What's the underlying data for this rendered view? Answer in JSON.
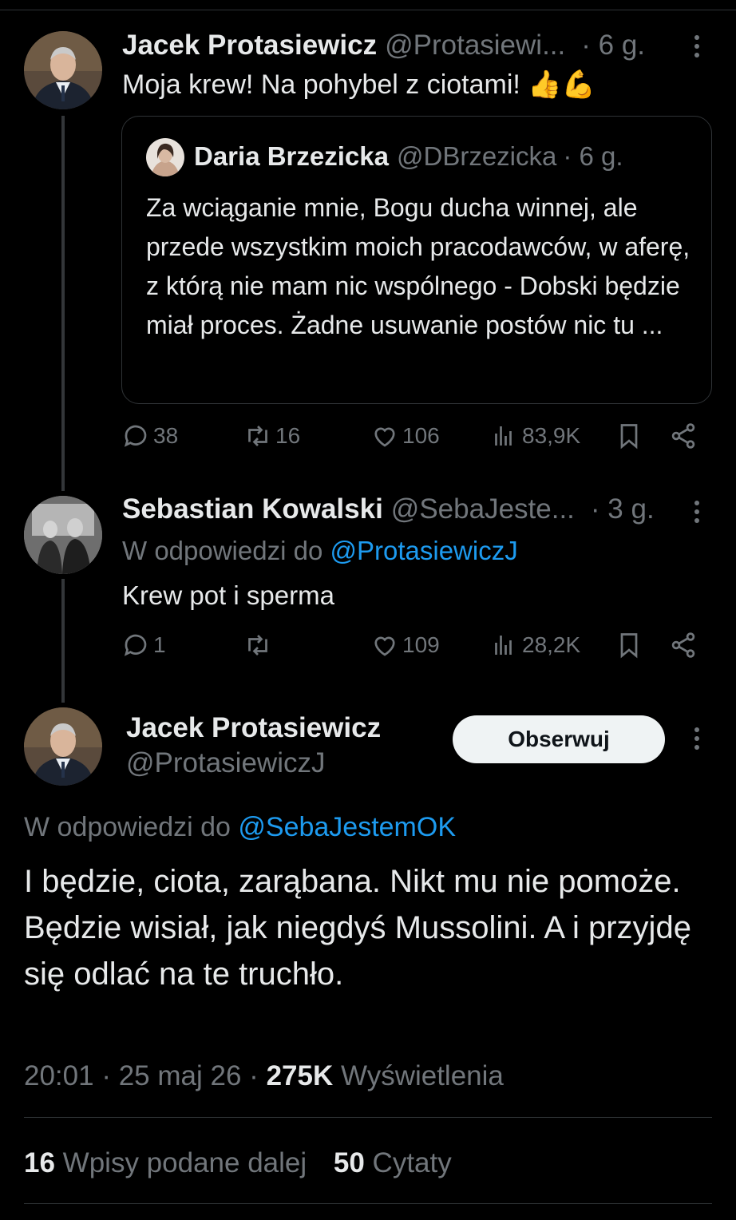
{
  "tweet1": {
    "name": "Jacek Protasiewicz",
    "handle": "@Protasiewi...",
    "time": "· 6 g.",
    "text": "Moja krew! Na pohybel z ciotami! 👍💪",
    "quote": {
      "name": "Daria Brzezicka",
      "handle": "@DBrzezicka",
      "time": "· 6 g.",
      "text": "Za wciąganie mnie, Bogu ducha winnej, ale przede wszystkim moich pracodawców, w aferę, z którą nie mam nic wspólnego - Dobski będzie miał proces. Żadne usuwanie postów nic tu ..."
    },
    "replies": "38",
    "reposts": "16",
    "likes": "106",
    "views": "83,9K"
  },
  "tweet2": {
    "name": "Sebastian Kowalski",
    "handle": "@SebaJeste...",
    "time": "· 3 g.",
    "reply_prefix": "W odpowiedzi do",
    "reply_to": "@ProtasiewiczJ",
    "text": "Krew pot i sperma",
    "replies": "1",
    "reposts": "",
    "likes": "109",
    "views": "28,2K"
  },
  "main": {
    "name": "Jacek Protasiewicz",
    "handle": "@ProtasiewiczJ",
    "follow_label": "Obserwuj",
    "reply_prefix": "W odpowiedzi do",
    "reply_to": "@SebaJestemOK",
    "text": "I będzie, ciota, zarąbana. Nikt mu nie pomoże. Będzie wisiał, jak niegdyś Mussolini. A i przyjdę się odlać  na te truchło.",
    "time": "20:01",
    "date": "25 maj 26",
    "views_count": "275K",
    "views_label": "Wyświetlenia",
    "reposts_count": "16",
    "reposts_label": "Wpisy podane dalej",
    "quotes_count": "50",
    "quotes_label": "Cytaty"
  },
  "icons": [
    "reply-icon",
    "repost-icon",
    "like-icon",
    "views-icon",
    "bookmark-icon",
    "share-icon",
    "more-icon"
  ],
  "colors": {
    "background": "#000000",
    "text": "#e7e9ea",
    "muted": "#71767b",
    "link": "#1d9bf0",
    "border": "#2f3336"
  }
}
